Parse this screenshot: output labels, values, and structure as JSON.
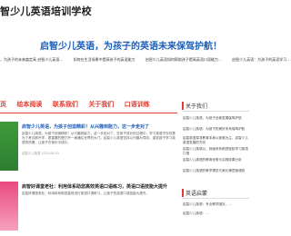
{
  "site": {
    "title": "智少儿英语培训学校"
  },
  "hero": {
    "headline": "启智少儿英语，为孩子的英语未来保驾护航！",
    "links": [
      "，为孩子的未来奠定高 启智少儿英语…",
      "如何在生活场景中提高孩子的英语能力",
      "启智少儿英语如何帮助孩子提高英语口语能力…",
      "启智少儿英语：为孩子的英语学习…"
    ]
  },
  "nav": {
    "items": [
      "页",
      "绘本阅读",
      "联系我们",
      "关于我们",
      "口语训练"
    ]
  },
  "posts": [
    {
      "title": "启智少儿英语，为孩子创造精彩！从兴趣到能力，这一步走对了",
      "body": "启智少儿英语，为孩子创造精彩！从兴趣到能力，这一步走对了。在孩子成长的过程中，学习英语不仅仅是为了考试和升学，更重要的是打开一扇通往世界的大门。启智少儿英语坚持以兴趣为导向，激发孩子学习英语的热情，让孩子在快乐中成长。",
      "meta": "启智少儿英语   2023-08-15"
    },
    {
      "title": "启智少儿英语研究：从自然中探索语言的秘密",
      "body": "启智少儿英语研究，引导孩子在自然和生活中学习英语，帮助孩子建立语言思维。",
      "meta": "启智少儿英语   2023-08-12"
    },
    {
      "title": "启智少儿英语，帮助学习者更快提升口语能力",
      "body": "启智少儿英语通过丰富的口语训练和情景模拟，帮助孩子更快提升口语表达能力。",
      "meta": "启智少儿英语   2023-08-10"
    },
    {
      "title": "启智好课堂课程：利用体系助您轻松掌握英语",
      "body": "启智好课堂课程以系统化的教学体系，帮助孩子循序渐进地掌握英语知识。",
      "meta": "启智少儿英语   2023-08-08"
    },
    {
      "title": "启智好课堂老社：利用体系助您高效英语口语练习，英语口语技能大提升",
      "body": "启智好课堂老社，利用体系助您高效进行英语口语练习，让孩子的英语口语技能大提升。",
      "meta": "启智少儿英语   2023-08-05"
    }
  ],
  "sidebar": {
    "about_title": "关于我们",
    "about_items": [
      "启智少儿英语，为孩子全面发展保驾护航",
      "启智少儿英语：为孩子的美好未来保驾护航",
      "启智英语探寻教育本身以家庭为主，启智少儿英语发展的方向",
      "启智少儿英语以，刻画体系助您轻松学习英语口语",
      "启智少儿英语的教育优势与实践效果分析",
      "启智少儿英语的教学理念与家长满意度调查"
    ],
    "fun_title": "英语启蒙",
    "fun_items": [
      "启智少儿英语：专业教学团队，…",
      "启智少儿英语：…"
    ]
  }
}
